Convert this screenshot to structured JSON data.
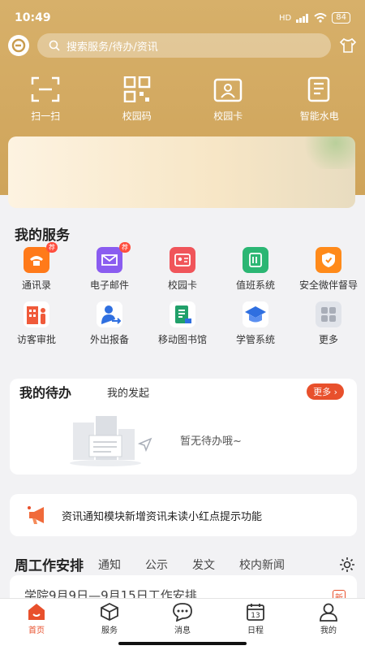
{
  "status": {
    "time": "10:49",
    "battery": "84",
    "hd": "HD"
  },
  "search": {
    "placeholder": "搜索服务/待办/资讯"
  },
  "quick_actions": [
    {
      "label": "扫一扫",
      "icon": "scan-icon"
    },
    {
      "label": "校园码",
      "icon": "qr-code-icon"
    },
    {
      "label": "校园卡",
      "icon": "id-card-icon"
    },
    {
      "label": "智能水电",
      "icon": "utility-meter-icon"
    }
  ],
  "my_services": {
    "title": "我的服务",
    "items": [
      {
        "label": "通讯录",
        "icon": "phone-icon",
        "color": "#ff7a1a",
        "badge": "荐"
      },
      {
        "label": "电子邮件",
        "icon": "mail-icon",
        "color": "#8a5cf0",
        "badge": "荐"
      },
      {
        "label": "校园卡",
        "icon": "id-card-icon",
        "color": "#f0555a",
        "badge": ""
      },
      {
        "label": "值班系统",
        "icon": "duty-icon",
        "color": "#2bb673",
        "badge": ""
      },
      {
        "label": "安全微伴督导",
        "icon": "shield-icon",
        "color": "#ff8a1a",
        "badge": ""
      },
      {
        "label": "访客审批",
        "icon": "visitor-icon",
        "color": "#f05a3a",
        "badge": ""
      },
      {
        "label": "外出报备",
        "icon": "outing-icon",
        "color": "#2f6fe0",
        "badge": ""
      },
      {
        "label": "移动图书馆",
        "icon": "library-icon",
        "color": "#21a06a",
        "badge": ""
      },
      {
        "label": "学管系统",
        "icon": "graduation-cap-icon",
        "color": "#2f6fe0",
        "badge": ""
      },
      {
        "label": "更多",
        "icon": "more-grid-icon",
        "color": "#c8ccd4",
        "badge": ""
      }
    ]
  },
  "todo": {
    "tab_active": "我的待办",
    "tab_other": "我的发起",
    "more": "更多",
    "empty_text": "暂无待办哦~"
  },
  "notice": {
    "text": "资讯通知模块新增资讯未读小红点提示功能"
  },
  "news": {
    "title": "周工作安排",
    "tabs": [
      "通知",
      "公示",
      "发文",
      "校内新闻"
    ],
    "first_item": "学院9月9日—9月15日工作安排",
    "new_tag": "新"
  },
  "bottom_nav": [
    {
      "label": "首页",
      "icon": "home-icon",
      "active": true
    },
    {
      "label": "服务",
      "icon": "cube-icon",
      "active": false
    },
    {
      "label": "消息",
      "icon": "message-icon",
      "active": false
    },
    {
      "label": "日程",
      "icon": "calendar-icon",
      "active": false
    },
    {
      "label": "我的",
      "icon": "user-icon",
      "active": false
    }
  ],
  "colors": {
    "header": "#d2a860",
    "accent": "#e8502c"
  }
}
